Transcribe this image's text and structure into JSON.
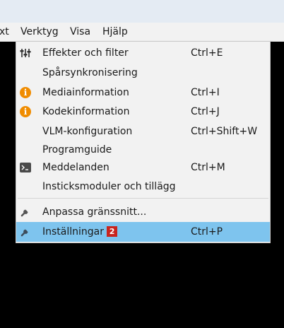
{
  "menubar": {
    "items": [
      {
        "label": "xt"
      },
      {
        "label": "Verktyg"
      },
      {
        "label": "Visa"
      },
      {
        "label": "Hjälp"
      }
    ]
  },
  "menu": {
    "items": [
      {
        "label": "Effekter och filter",
        "shortcut": "Ctrl+E",
        "icon": "equalizer-icon"
      },
      {
        "label": "Spårsynkronisering",
        "shortcut": "",
        "icon": ""
      },
      {
        "label": "Mediainformation",
        "shortcut": "Ctrl+I",
        "icon": "info-icon"
      },
      {
        "label": "Kodekinformation",
        "shortcut": "Ctrl+J",
        "icon": "info-icon"
      },
      {
        "label": "VLM-konfiguration",
        "shortcut": "Ctrl+Shift+W",
        "icon": ""
      },
      {
        "label": "Programguide",
        "shortcut": "",
        "icon": ""
      },
      {
        "label": "Meddelanden",
        "shortcut": "Ctrl+M",
        "icon": "terminal-icon"
      },
      {
        "label": "Insticksmoduler och tillägg",
        "shortcut": "",
        "icon": ""
      },
      {
        "label": "Anpassa gränssnitt...",
        "shortcut": "",
        "icon": "wrench-icon"
      },
      {
        "label": "Inställningar",
        "shortcut": "Ctrl+P",
        "icon": "wrench-icon",
        "badge": "2",
        "highlighted": true
      }
    ]
  },
  "colors": {
    "highlight": "#7ec4ee",
    "menu_bg": "#f2f2f2",
    "badge": "#c8241e",
    "info_icon": "#f08c00",
    "background": "#000000"
  }
}
